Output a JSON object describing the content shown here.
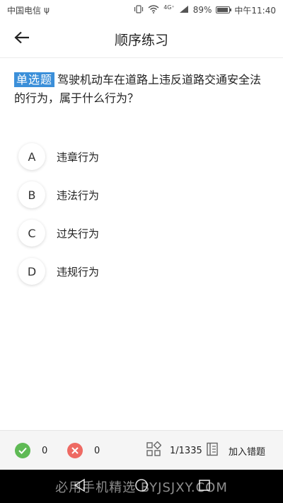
{
  "status_bar": {
    "carrier": "中国电信",
    "usb_symbol": "ψ",
    "network": "4G⁺",
    "battery_percent": "89%",
    "battery_level": 0.89,
    "time": "中午11:40"
  },
  "header": {
    "title": "顺序练习"
  },
  "question": {
    "type_label": "单选题",
    "text": "驾驶机动车在道路上违反道路交通安全法的行为，属于什么行为？"
  },
  "options": [
    {
      "letter": "A",
      "text": "违章行为"
    },
    {
      "letter": "B",
      "text": "违法行为"
    },
    {
      "letter": "C",
      "text": "过失行为"
    },
    {
      "letter": "D",
      "text": "违规行为"
    }
  ],
  "bottom_bar": {
    "correct_count": "0",
    "wrong_count": "0",
    "progress": "1/1335",
    "add_wrong_label": "加入错题"
  },
  "watermark": "必用手机精选 BYJSJXY.COM",
  "colors": {
    "badge": "#3b8fd9",
    "correct": "#5fba55",
    "wrong": "#ee6a63"
  }
}
